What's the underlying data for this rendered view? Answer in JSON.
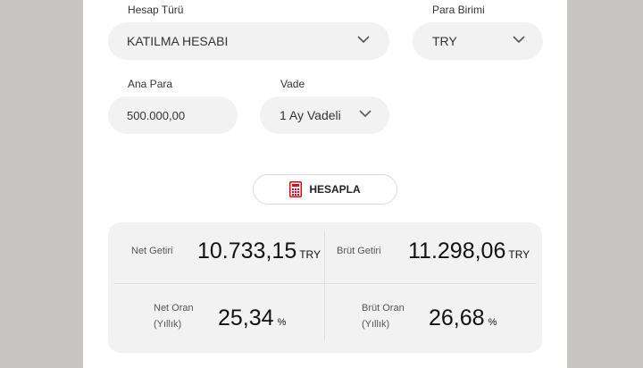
{
  "form": {
    "account_type": {
      "label": "Hesap Türü",
      "value": "KATILMA HESABI"
    },
    "currency": {
      "label": "Para Birimi",
      "value": "TRY"
    },
    "principal": {
      "label": "Ana Para",
      "value": "500.000,00"
    },
    "term": {
      "label": "Vade",
      "value": "1 Ay Vadeli"
    }
  },
  "calculate_button": {
    "label": "HESAPLA",
    "icon": "calculator-icon",
    "icon_color": "#e30613"
  },
  "results": {
    "net_return": {
      "label": "Net Getiri",
      "value": "10.733,15",
      "unit": "TRY"
    },
    "gross_return": {
      "label": "Brüt Getiri",
      "value": "11.298,06",
      "unit": "TRY"
    },
    "net_rate": {
      "label_line1": "Net Oran",
      "label_line2": "(Yıllık)",
      "value": "25,34",
      "unit": "%"
    },
    "gross_rate": {
      "label_line1": "Brüt Oran",
      "label_line2": "(Yıllık)",
      "value": "26,68",
      "unit": "%"
    }
  }
}
